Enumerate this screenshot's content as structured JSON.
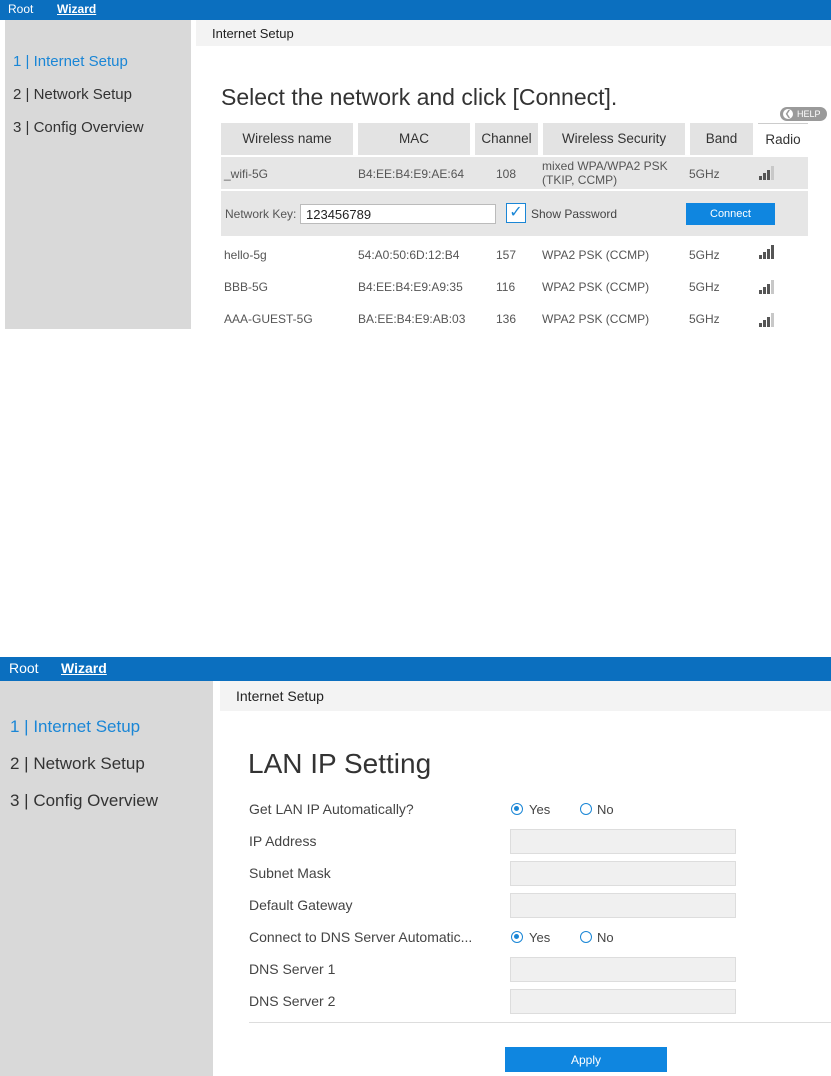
{
  "top": {
    "nav": {
      "root": "Root",
      "wizard": "Wizard"
    },
    "sidebar": [
      "1 | Internet Setup",
      "2 | Network Setup",
      "3 | Config Overview"
    ],
    "breadcrumb": "Internet Setup",
    "heading": "Select the network and click [Connect].",
    "help": "HELP",
    "columns": [
      "Wireless name",
      "MAC",
      "Channel",
      "Wireless Security",
      "Band",
      "Radio"
    ],
    "selected": {
      "name": "_wifi-5G",
      "mac": "B4:EE:B4:E9:AE:64",
      "channel": "108",
      "security_line1": "mixed WPA/WPA2 PSK",
      "security_line2": "(TKIP, CCMP)",
      "band": "5GHz",
      "signal": 3
    },
    "key_label": "Network Key:",
    "key_value": "123456789",
    "show_password": "Show Password",
    "connect": "Connect",
    "networks": [
      {
        "name": "hello-5g",
        "mac": "54:A0:50:6D:12:B4",
        "channel": "157",
        "security": "WPA2 PSK (CCMP)",
        "band": "5GHz",
        "signal": 4
      },
      {
        "name": "BBB-5G",
        "mac": "B4:EE:B4:E9:A9:35",
        "channel": "116",
        "security": "WPA2 PSK (CCMP)",
        "band": "5GHz",
        "signal": 3
      },
      {
        "name": "AAA-GUEST-5G",
        "mac": "BA:EE:B4:E9:AB:03",
        "channel": "136",
        "security": "WPA2 PSK (CCMP)",
        "band": "5GHz",
        "signal": 3
      }
    ]
  },
  "bottom": {
    "nav": {
      "root": "Root",
      "wizard": "Wizard"
    },
    "sidebar": [
      "1 | Internet Setup",
      "2 | Network Setup",
      "3 | Config Overview"
    ],
    "breadcrumb": "Internet Setup",
    "heading": "LAN IP Setting",
    "fields": {
      "auto_ip": "Get LAN IP Automatically?",
      "ip": "IP Address",
      "mask": "Subnet Mask",
      "gateway": "Default Gateway",
      "auto_dns": "Connect to DNS Server Automatic...",
      "dns1": "DNS Server 1",
      "dns2": "DNS Server 2"
    },
    "yes": "Yes",
    "no": "No",
    "apply": "Apply"
  },
  "colors": {
    "nav": "#0b6fbf",
    "accent": "#1a86d6",
    "button": "#0f86e0",
    "sidebar": "#d9d9d9"
  }
}
